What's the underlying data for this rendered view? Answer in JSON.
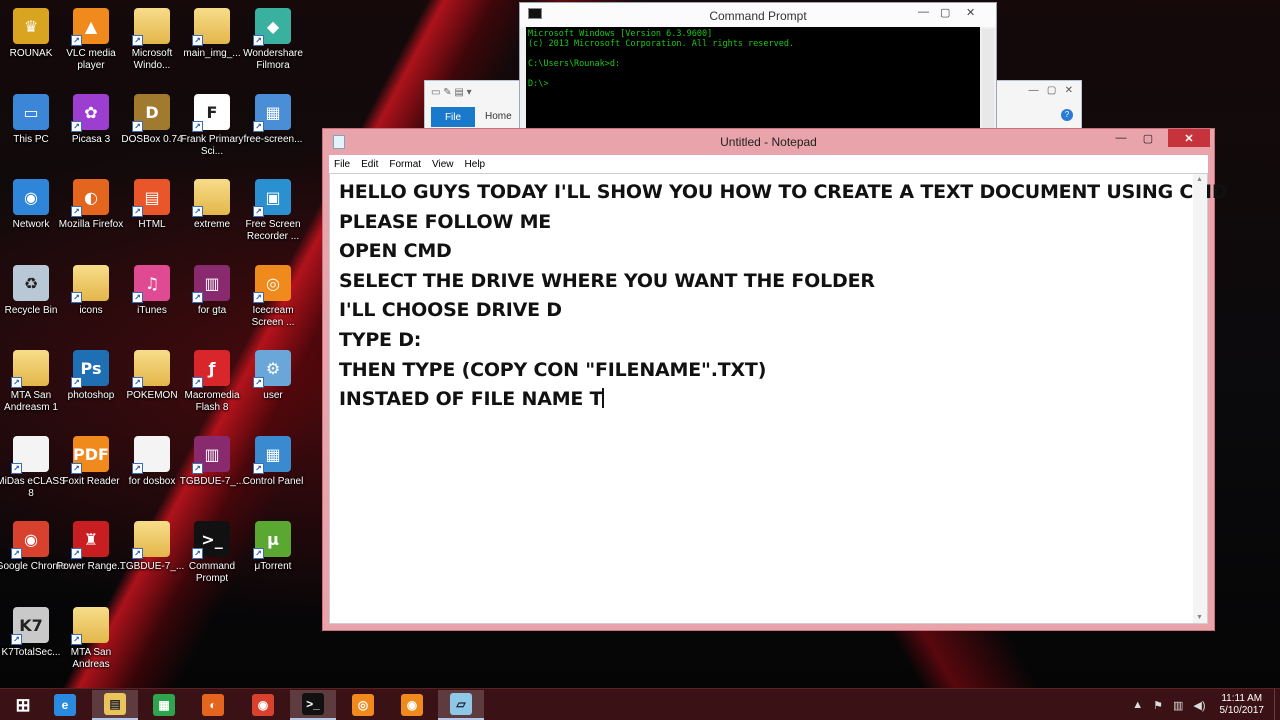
{
  "desktop": {
    "icons": [
      {
        "label": "ROUNAK",
        "icon": "user-folder-icon",
        "color": "#d9a520",
        "glyph": "♛"
      },
      {
        "label": "VLC media player",
        "icon": "vlc-icon",
        "color": "#f08a1c",
        "glyph": "▲"
      },
      {
        "label": "Microsoft Windo...",
        "icon": "folder-icon",
        "color": "folder",
        "glyph": ""
      },
      {
        "label": "main_img_...",
        "icon": "folder-icon",
        "color": "folder",
        "glyph": ""
      },
      {
        "label": "Wondershare Filmora",
        "icon": "filmora-icon",
        "color": "#3ab0a0",
        "glyph": "◆"
      },
      {
        "label": "This PC",
        "icon": "computer-icon",
        "color": "#3b86d6",
        "glyph": "▭"
      },
      {
        "label": "Picasa 3",
        "icon": "picasa-icon",
        "color": "#9c3fd1",
        "glyph": "✿"
      },
      {
        "label": "DOSBox 0.74",
        "icon": "dosbox-icon",
        "color": "#a07a2e",
        "glyph": "D"
      },
      {
        "label": "Frank Primary Sci...",
        "icon": "frank-icon",
        "color": "#ffffff",
        "glyph": "F"
      },
      {
        "label": "free-screen...",
        "icon": "installer-icon",
        "color": "#4a8ed6",
        "glyph": "▦"
      },
      {
        "label": "Network",
        "icon": "network-icon",
        "color": "#2f86d8",
        "glyph": "◉"
      },
      {
        "label": "Mozilla Firefox",
        "icon": "firefox-icon",
        "color": "#e4661e",
        "glyph": "◐"
      },
      {
        "label": "HTML",
        "icon": "html-icon",
        "color": "#e8562a",
        "glyph": "▤"
      },
      {
        "label": "extreme",
        "icon": "folder-icon",
        "color": "folder",
        "glyph": ""
      },
      {
        "label": "Free Screen Recorder ...",
        "icon": "screen-recorder-icon",
        "color": "#2a90d0",
        "glyph": "▣"
      },
      {
        "label": "Recycle Bin",
        "icon": "recycle-bin-icon",
        "color": "#b8c8d6",
        "glyph": "♻"
      },
      {
        "label": "icons",
        "icon": "folder-icon",
        "color": "folder",
        "glyph": ""
      },
      {
        "label": "iTunes",
        "icon": "itunes-icon",
        "color": "#e04a92",
        "glyph": "♫"
      },
      {
        "label": "for gta",
        "icon": "winrar-icon",
        "color": "#8a2a6e",
        "glyph": "▥"
      },
      {
        "label": "Icecream Screen ...",
        "icon": "icecream-icon",
        "color": "#f08a1c",
        "glyph": "◎"
      },
      {
        "label": "MTA San Andreasm 1",
        "icon": "folder-icon",
        "color": "folder",
        "glyph": ""
      },
      {
        "label": "photoshop",
        "icon": "photoshop-icon",
        "color": "#1f6fb5",
        "glyph": "Ps"
      },
      {
        "label": "POKEMON",
        "icon": "folder-icon",
        "color": "folder",
        "glyph": ""
      },
      {
        "label": "Macromedia Flash 8",
        "icon": "flash-icon",
        "color": "#d9262a",
        "glyph": "ƒ"
      },
      {
        "label": "user",
        "icon": "user-settings-icon",
        "color": "#6aa6d8",
        "glyph": "⚙"
      },
      {
        "label": "MiDas eCLASS 8",
        "icon": "document-icon",
        "color": "#f4f4f4",
        "glyph": ""
      },
      {
        "label": "Foxit Reader",
        "icon": "foxit-icon",
        "color": "#f08a1c",
        "glyph": "PDF"
      },
      {
        "label": "for dosbox",
        "icon": "document-icon",
        "color": "#f4f4f4",
        "glyph": ""
      },
      {
        "label": "TGBDUE-7_...",
        "icon": "winrar-icon",
        "color": "#8a2a6e",
        "glyph": "▥"
      },
      {
        "label": "Control Panel",
        "icon": "control-panel-icon",
        "color": "#3a8ad0",
        "glyph": "▦"
      },
      {
        "label": "Google Chrome",
        "icon": "chrome-icon",
        "color": "#d9412f",
        "glyph": "◉"
      },
      {
        "label": "Power Range...",
        "icon": "power-rangers-icon",
        "color": "#c81e22",
        "glyph": "♜"
      },
      {
        "label": "TGBDUE-7_...",
        "icon": "folder-icon",
        "color": "folder",
        "glyph": ""
      },
      {
        "label": "Command Prompt",
        "icon": "command-prompt-icon",
        "color": "#111111",
        "glyph": ">_"
      },
      {
        "label": "μTorrent",
        "icon": "utorrent-icon",
        "color": "#5aa832",
        "glyph": "μ"
      },
      {
        "label": "K7TotalSec...",
        "icon": "k7-icon",
        "color": "#c9c9c9",
        "glyph": "K7"
      },
      {
        "label": "MTA San Andreas",
        "icon": "folder-icon",
        "color": "folder",
        "glyph": ""
      }
    ]
  },
  "cmd": {
    "title": "Command Prompt",
    "lines": [
      "Microsoft Windows [Version 6.3.9600]",
      "(c) 2013 Microsoft Corporation. All rights reserved.",
      "",
      "C:\\Users\\Rounak>d:",
      "",
      "D:\\>"
    ]
  },
  "explorer": {
    "file_tab": "File",
    "home_tab": "Home"
  },
  "notepad": {
    "title": "Untitled - Notepad",
    "menu": [
      "File",
      "Edit",
      "Format",
      "View",
      "Help"
    ],
    "lines": [
      "HELLO GUYS TODAY I'LL SHOW YOU HOW TO CREATE A TEXT DOCUMENT USING CMD",
      "PLEASE FOLLOW ME",
      "OPEN CMD",
      "SELECT THE DRIVE WHERE YOU WANT THE FOLDER",
      "I'LL CHOOSE DRIVE D",
      "TYPE D:",
      "THEN TYPE (COPY CON \"FILENAME\".TXT)",
      "INSTAED OF FILE NAME T"
    ]
  },
  "taskbar": {
    "items": [
      {
        "name": "start-button",
        "icon": "windows-logo-icon",
        "color": "#ffffff",
        "glyph": "⊞"
      },
      {
        "name": "taskbar-ie",
        "icon": "internet-explorer-icon",
        "color": "#2a8ae0",
        "glyph": "e"
      },
      {
        "name": "taskbar-file-explorer",
        "icon": "file-explorer-icon",
        "color": "#e8c45a",
        "glyph": "▤"
      },
      {
        "name": "taskbar-store",
        "icon": "store-icon",
        "color": "#2ea44f",
        "glyph": "▦"
      },
      {
        "name": "taskbar-firefox",
        "icon": "firefox-icon",
        "color": "#e4661e",
        "glyph": "◐"
      },
      {
        "name": "taskbar-chrome",
        "icon": "chrome-icon",
        "color": "#d9412f",
        "glyph": "◉"
      },
      {
        "name": "taskbar-cmd",
        "icon": "command-prompt-icon",
        "color": "#111111",
        "glyph": ">_"
      },
      {
        "name": "taskbar-icecream-1",
        "icon": "icecream-icon",
        "color": "#f08a1c",
        "glyph": "◎"
      },
      {
        "name": "taskbar-icecream-2",
        "icon": "icecream-camera-icon",
        "color": "#f08a1c",
        "glyph": "◉"
      },
      {
        "name": "taskbar-notepad",
        "icon": "notepad-icon",
        "color": "#8ec8e8",
        "glyph": "▱"
      }
    ],
    "clock_time": "11:11 AM",
    "clock_date": "5/10/2017"
  }
}
